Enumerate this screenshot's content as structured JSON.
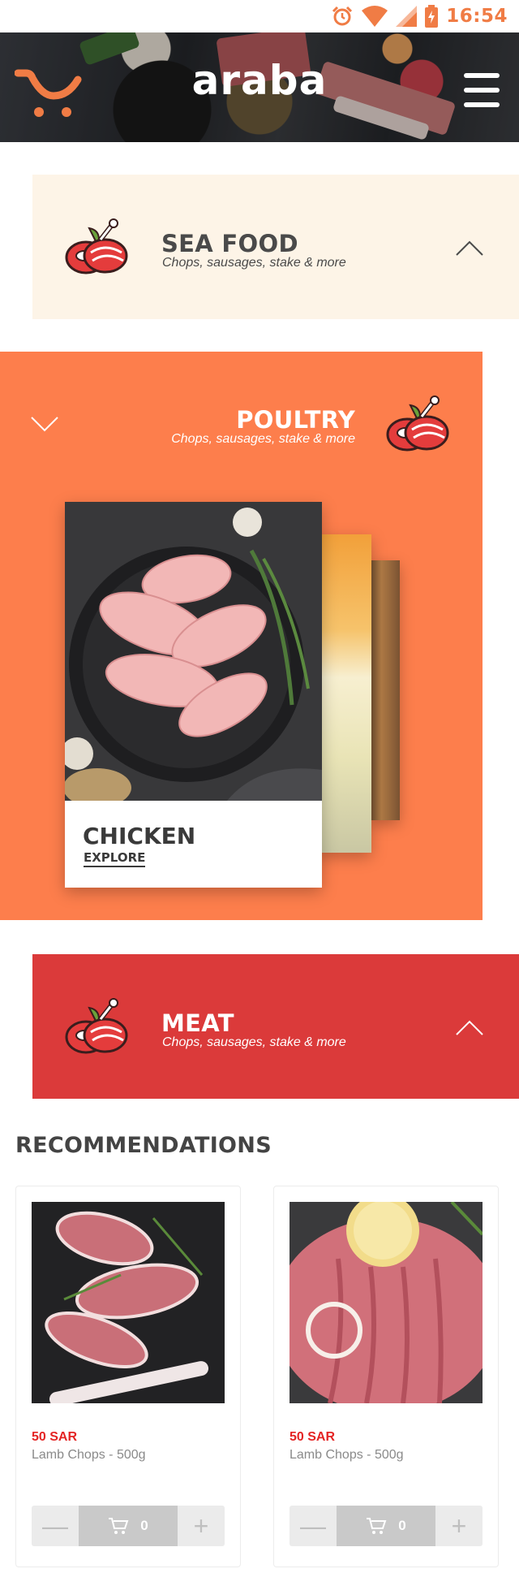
{
  "status_bar": {
    "time": "16:54",
    "icons": [
      "alarm-icon",
      "wifi-icon",
      "signal-icon",
      "battery-charging-icon"
    ],
    "color": "#f07c45"
  },
  "header": {
    "brand": "araba",
    "logo_icon": "cart-smile-icon",
    "menu_icon": "hamburger-menu-icon"
  },
  "categories": [
    {
      "title": "SEA FOOD",
      "subtitle": "Chops, sausages, stake & more",
      "icon": "meat-steak-icon",
      "state": "collapsed",
      "chevron": "chevron-up-icon",
      "background": "#fdf4e7"
    },
    {
      "title": "POULTRY",
      "subtitle": "Chops, sausages, stake & more",
      "icon": "meat-steak-icon",
      "state": "expanded",
      "chevron": "chevron-down-icon",
      "background": "#fd7e4c",
      "carousel": {
        "active_item": {
          "title": "CHICKEN",
          "link": "EXPLORE"
        }
      }
    },
    {
      "title": "MEAT",
      "subtitle": "Chops, sausages, stake & more",
      "icon": "meat-steak-icon",
      "state": "collapsed",
      "chevron": "chevron-up-icon",
      "background": "#db3a3a"
    }
  ],
  "recommendations": {
    "title": "RECOMMENDATIONS",
    "products": [
      {
        "price": "50 SAR",
        "name": "Lamb Chops - 500g",
        "quantity": "0",
        "minus_icon": "minus-icon",
        "cart_icon": "cart-icon",
        "plus_icon": "plus-icon"
      },
      {
        "price": "50 SAR",
        "name": "Lamb Chops - 500g",
        "quantity": "0",
        "minus_icon": "minus-icon",
        "cart_icon": "cart-icon",
        "plus_icon": "plus-icon"
      }
    ]
  },
  "colors": {
    "accent": "#f07c45",
    "price": "#e42424"
  }
}
